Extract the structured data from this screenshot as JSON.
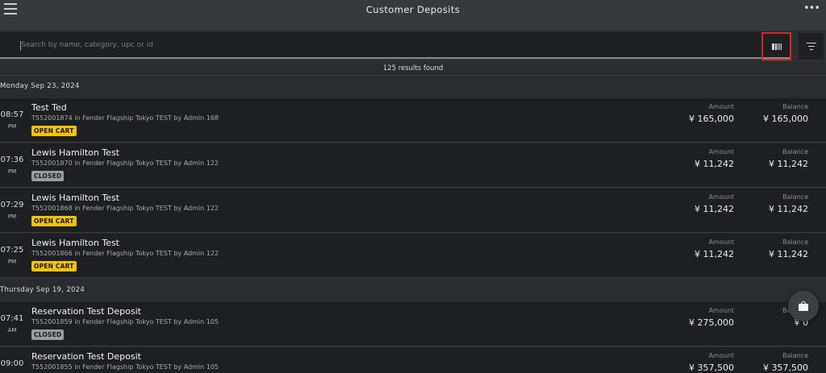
{
  "header": {
    "title": "Customer Deposits",
    "more_label": "•••"
  },
  "search": {
    "placeholder": "Search by name, category, upc or id"
  },
  "results_text": "125 results found",
  "columns": {
    "amount": "Amount",
    "balance": "Balance"
  },
  "groups": [
    {
      "date": "Monday Sep 23, 2024",
      "rows": [
        {
          "time": "08:57",
          "ampm": "PM",
          "name": "Test Ted",
          "sub": "T552001874 in Fender Flagship Tokyo TEST by Admin 168",
          "status": "OPEN CART",
          "amount": "¥ 165,000",
          "balance": "¥ 165,000"
        },
        {
          "time": "07:36",
          "ampm": "PM",
          "name": "Lewis Hamilton Test",
          "sub": "T552001870 in Fender Flagship Tokyo TEST by Admin 122",
          "status": "CLOSED",
          "amount": "¥ 11,242",
          "balance": "¥ 11,242"
        },
        {
          "time": "07:29",
          "ampm": "PM",
          "name": "Lewis Hamilton Test",
          "sub": "T552001868 in Fender Flagship Tokyo TEST by Admin 122",
          "status": "OPEN CART",
          "amount": "¥ 11,242",
          "balance": "¥ 11,242"
        },
        {
          "time": "07:25",
          "ampm": "PM",
          "name": "Lewis Hamilton Test",
          "sub": "T552001866 in Fender Flagship Tokyo TEST by Admin 122",
          "status": "OPEN CART",
          "amount": "¥ 11,242",
          "balance": "¥ 11,242"
        }
      ]
    },
    {
      "date": "Thursday Sep 19, 2024",
      "rows": [
        {
          "time": "07:41",
          "ampm": "AM",
          "name": "Reservation Test Deposit",
          "sub": "T552001859 in Fender Flagship Tokyo TEST by Admin 105",
          "status": "CLOSED",
          "amount": "¥ 275,000",
          "balance": "¥ 0"
        },
        {
          "time": "09:00",
          "ampm": "",
          "name": "Reservation Test Deposit",
          "sub": "T552001855 in Fender Flagship Tokyo TEST by Admin 105",
          "status": "",
          "amount": "¥ 357,500",
          "balance": "¥ 357,500"
        }
      ]
    }
  ],
  "colors": {
    "open_cart": "#f4c20d",
    "closed": "#9b9b9b",
    "highlight_border": "#d12a2a"
  },
  "icons": {
    "menu": "hamburger-icon",
    "more": "more-dots-icon",
    "barcode": "barcode-icon",
    "filter": "filter-icon",
    "fab": "shopping-bag-icon"
  }
}
